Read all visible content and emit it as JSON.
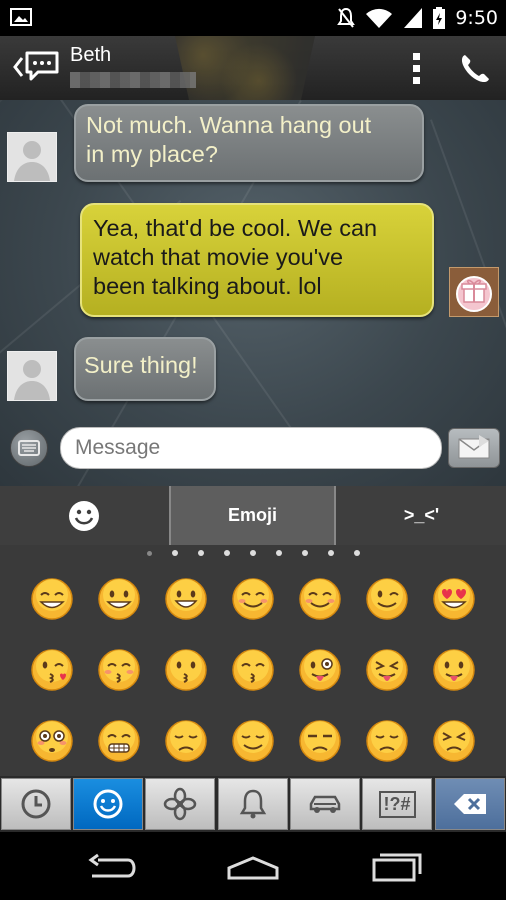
{
  "status_bar": {
    "time": "9:50"
  },
  "header": {
    "contact_name": "Beth"
  },
  "messages": [
    {
      "direction": "received",
      "lines": [
        "Not much. Wanna hang out",
        "in my place?"
      ]
    },
    {
      "direction": "sent",
      "lines": [
        "Yea, that'd be cool. We can",
        "watch that movie you've",
        "been talking about. lol"
      ]
    },
    {
      "direction": "received",
      "lines": [
        "Sure thing!"
      ]
    }
  ],
  "compose": {
    "placeholder": "Message"
  },
  "keyboard": {
    "tabs": [
      {
        "label": "",
        "icon": "smiley-icon"
      },
      {
        "label": "Emoji",
        "active": true
      },
      {
        "label": ">_<'"
      }
    ],
    "page_count": 9,
    "emoji_grid": [
      [
        "grin",
        "smile",
        "smile-open",
        "blush",
        "relaxed",
        "wink",
        "heart-eyes"
      ],
      [
        "kiss-heart",
        "kiss-closed",
        "kiss",
        "kiss-smile",
        "tongue-wink",
        "tongue-closed",
        "tongue"
      ],
      [
        "flushed",
        "grimace",
        "pensive",
        "relieved",
        "unamused",
        "disappointed",
        "persevere"
      ]
    ],
    "categories": [
      {
        "name": "recent",
        "icon": "clock-icon"
      },
      {
        "name": "people",
        "icon": "smiley-icon",
        "active": true
      },
      {
        "name": "nature",
        "icon": "flower-icon"
      },
      {
        "name": "objects",
        "icon": "bell-icon"
      },
      {
        "name": "places",
        "icon": "car-icon"
      },
      {
        "name": "symbols",
        "label": "!?#"
      },
      {
        "name": "delete",
        "icon": "backspace-icon"
      }
    ]
  }
}
